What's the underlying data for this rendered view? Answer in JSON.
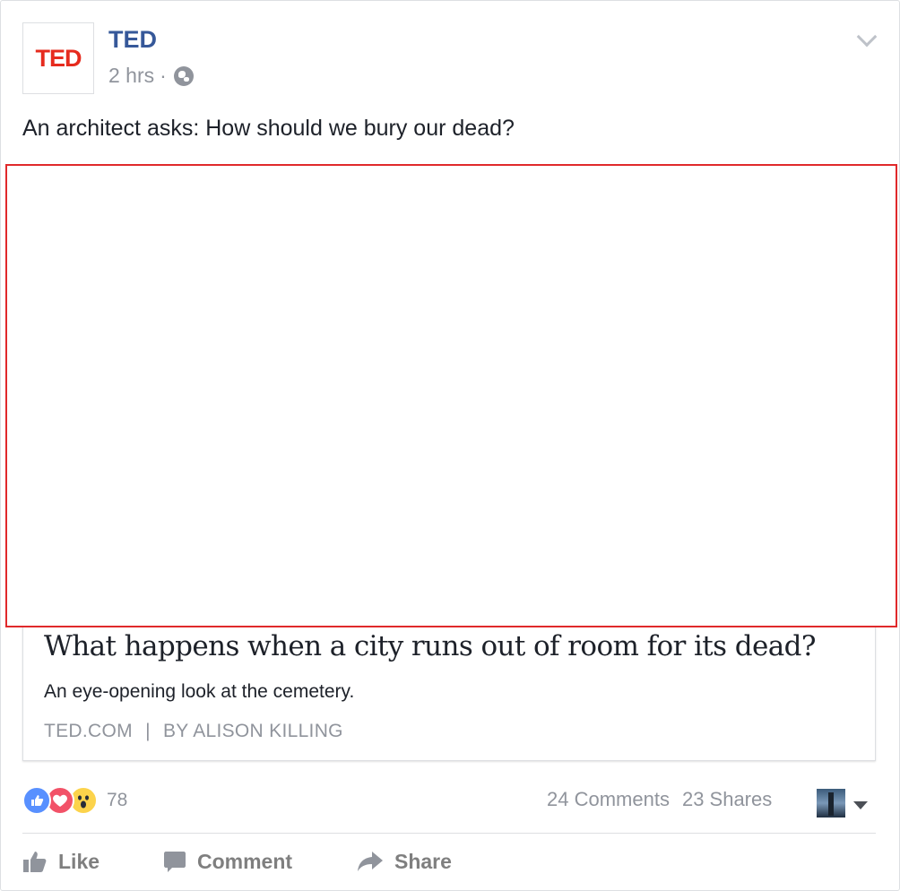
{
  "post": {
    "page_name": "TED",
    "avatar_text": "TED",
    "timestamp": "2 hrs",
    "separator": "·",
    "privacy_icon": "globe-icon",
    "text": "An architect asks: How should we bury our dead?"
  },
  "link_preview": {
    "title": "What happens when a city runs out of room for its dead?",
    "description": "An eye-opening look at the cemetery.",
    "source": "TED.COM",
    "source_separator": "|",
    "byline": "BY ALISON KILLING"
  },
  "engagement": {
    "reaction_icons": [
      "like-reaction-icon",
      "love-reaction-icon",
      "wow-reaction-icon"
    ],
    "reaction_count": "78",
    "comments": "24 Comments",
    "shares": "23 Shares"
  },
  "actions": {
    "like_label": "Like",
    "comment_label": "Comment",
    "share_label": "Share"
  },
  "colors": {
    "link_blue": "#365899",
    "ted_red": "#e62b1e",
    "muted_text": "#90949c",
    "highlight_border": "#e0292b"
  }
}
